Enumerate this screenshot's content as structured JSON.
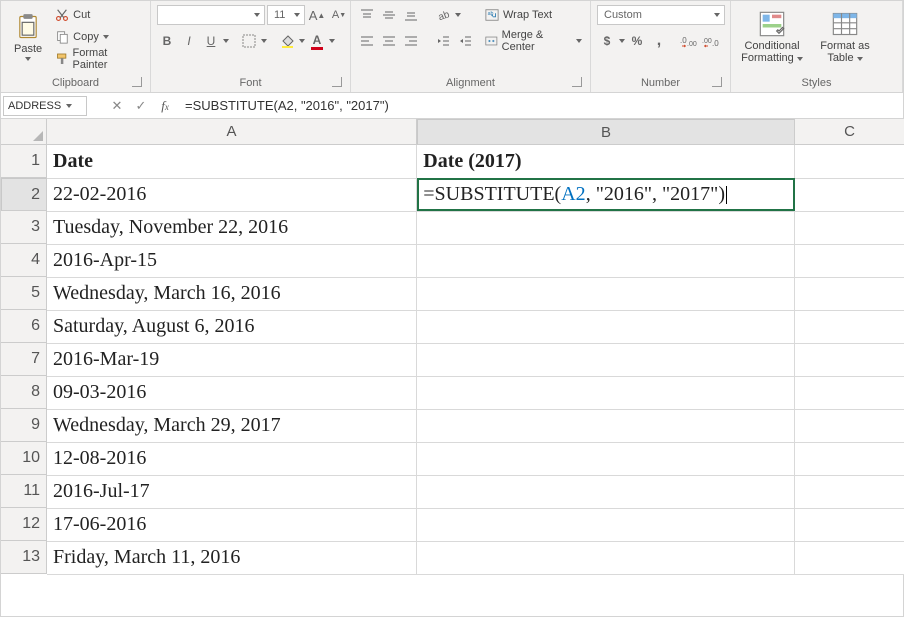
{
  "ribbon": {
    "clipboard": {
      "paste": "Paste",
      "cut": "Cut",
      "copy": "Copy",
      "format_painter": "Format Painter",
      "label": "Clipboard"
    },
    "font": {
      "font_name": "",
      "font_size": "11",
      "bold": "B",
      "italic": "I",
      "underline": "U",
      "label": "Font"
    },
    "alignment": {
      "wrap_text": "Wrap Text",
      "merge_center": "Merge & Center",
      "label": "Alignment"
    },
    "number": {
      "format": "Custom",
      "label": "Number"
    },
    "styles": {
      "cond_fmt_l1": "Conditional",
      "cond_fmt_l2": "Formatting",
      "fmt_table_l1": "Format as",
      "fmt_table_l2": "Table",
      "label": "Styles"
    }
  },
  "namebox": "ADDRESS",
  "formula_bar": "=SUBSTITUTE(A2, \"2016\", \"2017\")",
  "columns": {
    "A": "A",
    "B": "B",
    "C": "C"
  },
  "headers": {
    "A": "Date",
    "B": "Date (2017)"
  },
  "editing_cell": {
    "prefix": "=SUBSTITUTE(",
    "ref": "A2",
    "suffix": ", \"2016\", \"2017\")"
  },
  "rows": [
    "22-02-2016",
    "Tuesday, November 22, 2016",
    "2016-Apr-15",
    "Wednesday, March 16, 2016",
    "Saturday, August 6, 2016",
    "2016-Mar-19",
    "09-03-2016",
    "Wednesday, March 29, 2017",
    "12-08-2016",
    "2016-Jul-17",
    "17-06-2016",
    "Friday, March 11, 2016"
  ],
  "row_numbers": [
    "1",
    "2",
    "3",
    "4",
    "5",
    "6",
    "7",
    "8",
    "9",
    "10",
    "11",
    "12",
    "13"
  ],
  "chart_data": {
    "type": "table",
    "columns": [
      "Date",
      "Date (2017)"
    ],
    "rows": [
      [
        "22-02-2016",
        "=SUBSTITUTE(A2, \"2016\", \"2017\")"
      ],
      [
        "Tuesday, November 22, 2016",
        ""
      ],
      [
        "2016-Apr-15",
        ""
      ],
      [
        "Wednesday, March 16, 2016",
        ""
      ],
      [
        "Saturday, August 6, 2016",
        ""
      ],
      [
        "2016-Mar-19",
        ""
      ],
      [
        "09-03-2016",
        ""
      ],
      [
        "Wednesday, March 29, 2017",
        ""
      ],
      [
        "12-08-2016",
        ""
      ],
      [
        "2016-Jul-17",
        ""
      ],
      [
        "17-06-2016",
        ""
      ],
      [
        "Friday, March 11, 2016",
        ""
      ]
    ]
  }
}
